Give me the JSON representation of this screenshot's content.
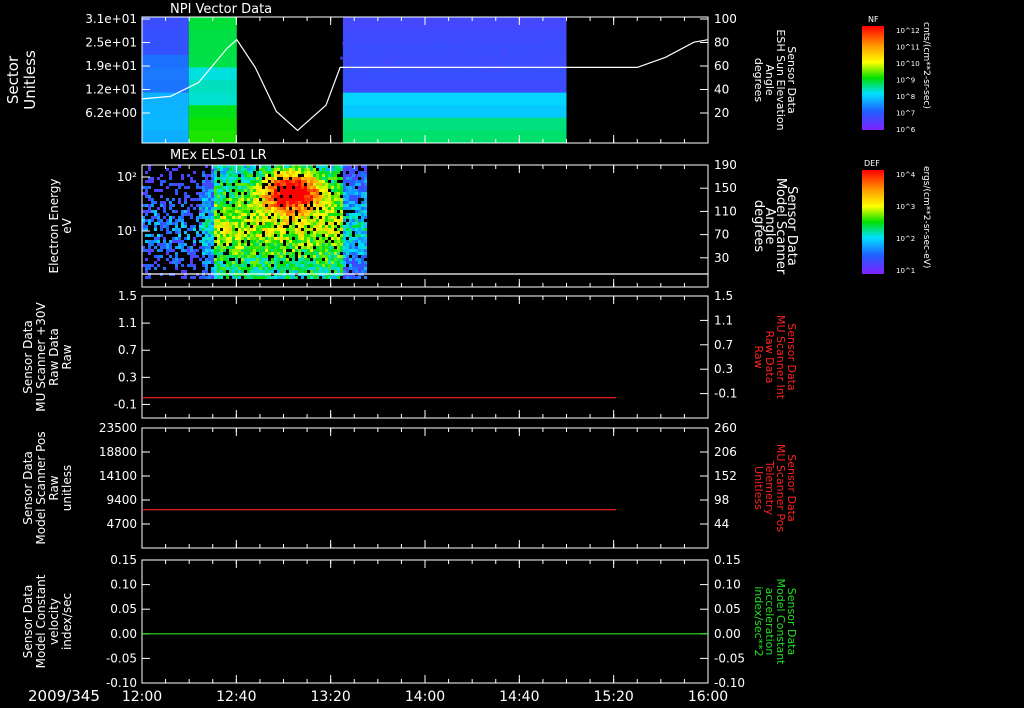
{
  "time_axis": {
    "date_label": "2009/345",
    "ticks": [
      "12:00",
      "12:40",
      "13:20",
      "14:00",
      "14:40",
      "15:20",
      "16:00"
    ],
    "range_hours": [
      12.0,
      16.0
    ]
  },
  "colorbars": [
    {
      "label": "NF",
      "unit": "cnts/(cm**2-sr-sec)",
      "ticks": [
        "10^12",
        "10^11",
        "10^10",
        "10^9",
        "10^8",
        "10^7",
        "10^6"
      ],
      "scale": "log"
    },
    {
      "label": "DEF",
      "unit": "ergs/(cm**2-sr-sec-eV)",
      "ticks": [
        "10^4",
        "10^3",
        "10^2",
        "10^1"
      ],
      "scale": "log"
    }
  ],
  "chart_data": [
    {
      "type": "heatmap",
      "title": "NPI Vector Data",
      "ylabel": [
        "Sector",
        "Unitless"
      ],
      "ylim": [
        0,
        31
      ],
      "yticks": [
        "3.1e+01",
        "2.5e+01",
        "1.9e+01",
        "1.2e+01",
        "6.2e+00"
      ],
      "ytick_values": [
        31,
        25,
        19,
        12,
        6.2
      ],
      "colorbar": "NF",
      "bands": [
        {
          "t0": 12.0,
          "t1": 12.67,
          "y0": 0,
          "y1": 31,
          "level": 0.45
        },
        {
          "t0": 12.67,
          "t1": 13.25,
          "y0": 0,
          "y1": 31,
          "level": 0.05,
          "gap": true
        },
        {
          "t0": 13.25,
          "t1": 13.42,
          "y0": 0,
          "y1": 31,
          "level": 0.05,
          "gap": true
        },
        {
          "t0": 13.42,
          "t1": 15.0,
          "y0": 0,
          "y1": 12,
          "level": 0.5
        },
        {
          "t0": 13.42,
          "t1": 15.0,
          "y0": 12,
          "y1": 31,
          "level": 0.15
        }
      ],
      "overlay": {
        "name": "Sensor Data ESH Sun Elevation Angle degrees",
        "ylabel_right": [
          "Sensor Data",
          "ESH Sun Elevation",
          "Angle",
          "degrees"
        ],
        "ylim_right": [
          0,
          100
        ],
        "yticks_right": [
          100,
          80,
          60,
          40,
          20
        ],
        "color": "#ffffff",
        "x": [
          12.0,
          12.2,
          12.4,
          12.6,
          12.67,
          12.8,
          12.95,
          13.1,
          13.3,
          13.4,
          13.5,
          14.0,
          15.0,
          15.5,
          15.7,
          15.9,
          16.0
        ],
        "y": [
          35,
          37,
          48,
          75,
          82,
          60,
          25,
          10,
          30,
          60,
          60,
          60,
          60,
          60,
          68,
          80,
          82
        ]
      }
    },
    {
      "type": "heatmap",
      "title": "MEx ELS-01 LR",
      "ylabel": [
        "Electron Energy",
        "eV"
      ],
      "yscale": "log",
      "ylim": [
        0.2,
        190
      ],
      "yticks": [
        "10²",
        "10¹"
      ],
      "colorbar": "DEF",
      "data_extent_hours": [
        12.0,
        13.58
      ],
      "overlay": {
        "name": "Sensor Data Model Scanner Angle degrees",
        "ylabel_right": [
          "Sensor Data",
          "Model Scanner",
          "Angle",
          "degrees"
        ],
        "ylim_right": [
          0,
          190
        ],
        "yticks_right": [
          190,
          150,
          110,
          70,
          30
        ],
        "color": "#ffffff",
        "x": [
          12.0,
          16.0
        ],
        "y": [
          0,
          0
        ]
      }
    },
    {
      "type": "line",
      "ylabel": [
        "Sensor Data",
        "MU Scanner +30V",
        "Raw Data",
        "Raw"
      ],
      "ylim": [
        -0.3,
        1.5
      ],
      "yticks": [
        "1.5",
        "1.1",
        "0.7",
        "0.3",
        "-0.1"
      ],
      "ytick_values": [
        1.5,
        1.1,
        0.7,
        0.3,
        -0.1
      ],
      "ylabel_right": [
        "Sensor Data",
        "MU Scanner Int",
        "Raw Data",
        "Raw"
      ],
      "ylabel_right_color": "#ff2020",
      "ylim_right": [
        -0.3,
        1.5
      ],
      "yticks_right": [
        "1.5",
        "1.1",
        "0.7",
        "0.3",
        "-0.1"
      ],
      "series": [
        {
          "color": "#ff2020",
          "x": [
            12.0,
            15.35
          ],
          "y": [
            0.0,
            0.0
          ]
        }
      ]
    },
    {
      "type": "line",
      "ylabel": [
        "Sensor Data",
        "Model Scanner Pos",
        "Raw",
        "unitless"
      ],
      "ylim": [
        0,
        23500
      ],
      "yticks": [
        "23500",
        "18800",
        "14100",
        "9400",
        "4700"
      ],
      "ytick_values": [
        23500,
        18800,
        14100,
        9400,
        4700
      ],
      "ylabel_right": [
        "Sensor Data",
        "MU Scanner Pos",
        "Telemetry",
        "Unitless"
      ],
      "ylabel_right_color": "#ff2020",
      "ylim_right": [
        0,
        260
      ],
      "yticks_right": [
        "260",
        "206",
        "152",
        "98",
        "44"
      ],
      "series": [
        {
          "color": "#ff2020",
          "x": [
            12.0,
            15.35
          ],
          "y": [
            7500,
            7500
          ]
        }
      ]
    },
    {
      "type": "line",
      "ylabel": [
        "Sensor Data",
        "Model Constant",
        "velocity",
        "index/sec"
      ],
      "ylim": [
        -0.1,
        0.15
      ],
      "yticks": [
        "0.15",
        "0.10",
        "0.05",
        "0.00",
        "-0.05",
        "-0.10"
      ],
      "ytick_values": [
        0.15,
        0.1,
        0.05,
        0.0,
        -0.05,
        -0.1
      ],
      "ylabel_right": [
        "Sensor Data",
        "Model Constant",
        "acceleration",
        "index/sec**2"
      ],
      "ylabel_right_color": "#20e020",
      "ylim_right": [
        -0.1,
        0.15
      ],
      "yticks_right": [
        "0.15",
        "0.10",
        "0.05",
        "0.00",
        "-0.05",
        "-0.10"
      ],
      "series": [
        {
          "color": "#20e020",
          "x": [
            12.0,
            16.0
          ],
          "y": [
            0.0,
            0.0
          ]
        }
      ]
    }
  ]
}
